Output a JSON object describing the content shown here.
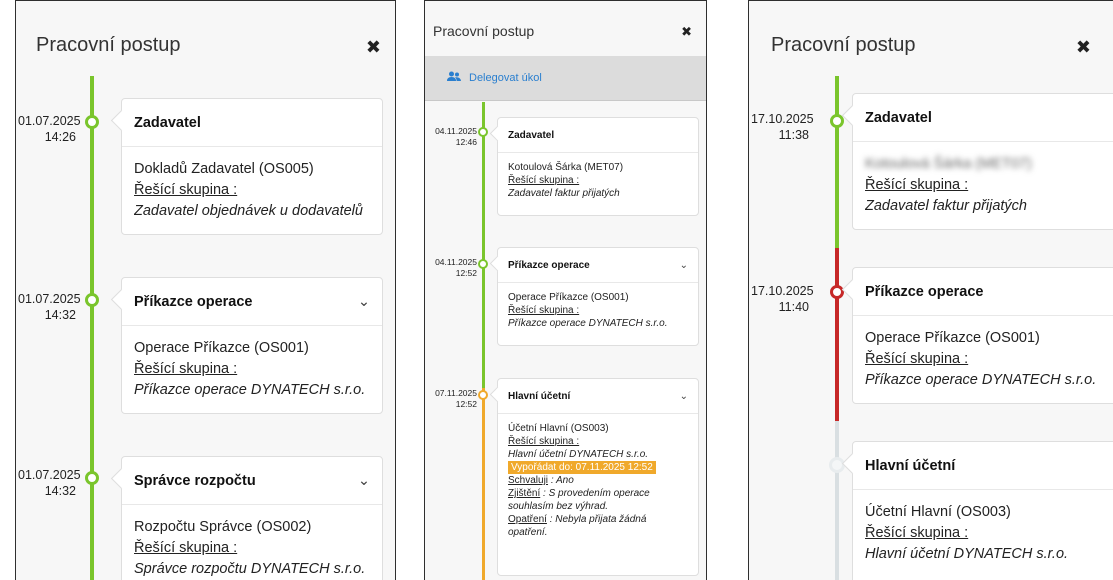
{
  "colors": {
    "green": "#7ac52c",
    "orange": "#f0a92b",
    "red": "#c62828",
    "grey": "#d9dfe2",
    "link": "#2a7fcf"
  },
  "panel1": {
    "title": "Pracovní postup",
    "close": "✖",
    "steps": [
      {
        "date": "01.07.2025",
        "time": "14:26",
        "title": "Zadavatel",
        "chevron": false,
        "person": "Dokladů Zadavatel (OS005)",
        "group_label": "Řešící skupina :",
        "group": "Zadavatel objednávek u dodavatelů"
      },
      {
        "date": "01.07.2025",
        "time": "14:32",
        "title": "Příkazce operace",
        "chevron": true,
        "person": "Operace Příkazce (OS001)",
        "group_label": "Řešící skupina :",
        "group": "Příkazce operace DYNATECH s.r.o."
      },
      {
        "date": "01.07.2025",
        "time": "14:32",
        "title": "Správce rozpočtu",
        "chevron": true,
        "person": "Rozpočtu Správce (OS002)",
        "group_label": "Řešící skupina :",
        "group": "Správce rozpočtu DYNATECH s.r.o."
      }
    ]
  },
  "panel2": {
    "title": "Pracovní postup",
    "close": "✖",
    "delegate": "Delegovat úkol",
    "steps": [
      {
        "date": "04.11.2025",
        "time": "12:46",
        "title": "Zadavatel",
        "person": "Kotoulová Šárka (MET07)",
        "group_label": "Řešící skupina :",
        "group": "Zadavatel faktur přijatých"
      },
      {
        "date": "04.11.2025",
        "time": "12:52",
        "title": "Příkazce operace",
        "person": "Operace Příkazce (OS001)",
        "group_label": "Řešící skupina :",
        "group": "Příkazce operace DYNATECH s.r.o."
      },
      {
        "date": "07.11.2025",
        "time": "12:52",
        "title": "Hlavní účetní",
        "person": "Účetní Hlavní (OS003)",
        "group_label": "Řešící skupina :",
        "group": "Hlavní účetní DYNATECH s.r.o.",
        "deadline": "Vypořádat do: 07.11.2025 12:52",
        "approve_label": "Schvaluji",
        "approve_value": ": Ano",
        "finding_label": "Zjištění",
        "finding_value": ": S provedením operace souhlasím bez výhrad.",
        "measure_label": "Opatření",
        "measure_value": ": Nebyla přijata žádná opatření."
      }
    ]
  },
  "panel3": {
    "title": "Pracovní postup",
    "close": "✖",
    "steps": [
      {
        "date": "17.10.2025",
        "time": "11:38",
        "title": "Zadavatel",
        "person": "Kotoulová Šárka (MET07)",
        "group_label": "Řešící skupina :",
        "group": "Zadavatel faktur přijatých"
      },
      {
        "date": "17.10.2025",
        "time": "11:40",
        "title": "Příkazce operace",
        "person": "Operace Příkazce (OS001)",
        "group_label": "Řešící skupina :",
        "group": "Příkazce operace DYNATECH s.r.o."
      },
      {
        "date": "",
        "time": "",
        "title": "Hlavní účetní",
        "person": "Účetní Hlavní (OS003)",
        "group_label": "Řešící skupina :",
        "group": "Hlavní účetní DYNATECH s.r.o."
      }
    ]
  }
}
